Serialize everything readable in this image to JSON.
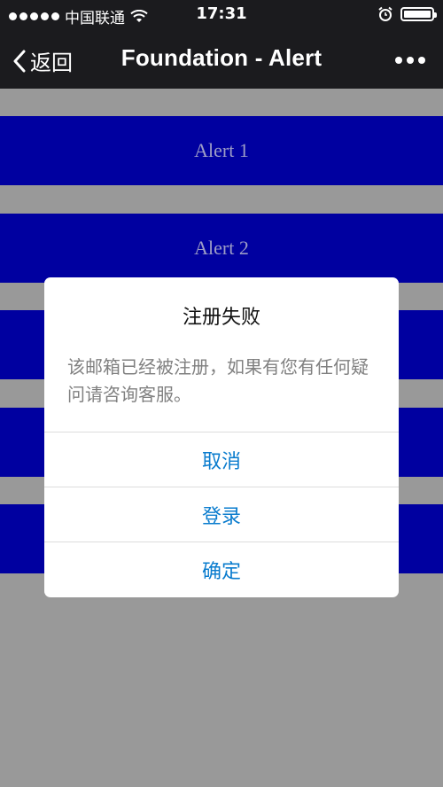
{
  "status_bar": {
    "carrier": "中国联通",
    "time": "17:31",
    "icons": [
      "signal-dots-icon",
      "wifi-icon",
      "alarm-icon",
      "battery-icon"
    ]
  },
  "nav": {
    "back_label": "返回",
    "title": "Foundation - Alert",
    "more_icon": "more-dots-icon"
  },
  "buttons": [
    {
      "label": "Alert 1"
    },
    {
      "label": "Alert 2"
    },
    {
      "label": ""
    },
    {
      "label": ""
    },
    {
      "label": ""
    }
  ],
  "dialog": {
    "title": "注册失败",
    "message": "该邮箱已经被注册，如果有您有任何疑问请咨询客服。",
    "actions": [
      {
        "label": "取消"
      },
      {
        "label": "登录"
      },
      {
        "label": "确定"
      }
    ]
  },
  "colors": {
    "nav_bg": "#1b1b1e",
    "page_bg": "#999999",
    "button_bg": "#0000a0",
    "button_text": "#9d9dc6",
    "action_text": "#0a7cce"
  }
}
